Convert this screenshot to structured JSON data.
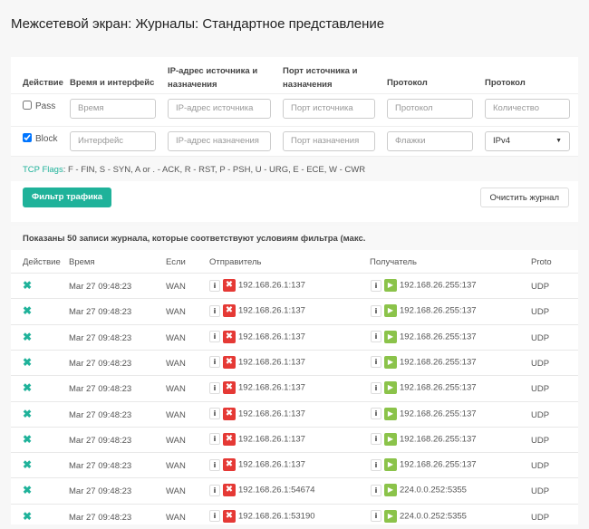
{
  "title": "Межсетевой экран: Журналы: Стандартное представление",
  "filter": {
    "headers": [
      "Действие",
      "Время и интерфейс",
      "IP-адрес источника и назначения",
      "Порт источника и назначения",
      "Протокол",
      "Протокол"
    ],
    "pass_label": "Pass",
    "pass_checked": false,
    "block_label": "Block",
    "block_checked": true,
    "row1": [
      "Время",
      "IP-адрес источника",
      "Порт источника",
      "Протокол",
      "Количество"
    ],
    "row2": [
      "Интерфейс",
      "IP-адрес назначения",
      "Порт назначения",
      "Флажки протокола"
    ],
    "ip_version": "IPv4",
    "tcp_flags_label": "TCP Flags",
    "tcp_flags_text": ": F - FIN, S - SYN, A or . - ACK, R - RST, P - PSH, U - URG, E - ECE, W - CWR",
    "filter_button": "Фильтр трафика",
    "clear_button": "Очистить журнал"
  },
  "logs": {
    "summary": "Показаны 50 записи журнала, которые соответствуют условиям фильтра (макс.",
    "columns": [
      "Действие",
      "Время",
      "Если",
      "Отправитель",
      "Получатель",
      "Proto"
    ],
    "rows": [
      {
        "time": "Mar 27 09:48:23",
        "if": "WAN",
        "src": "192.168.26.1:137",
        "dst": "192.168.26.255:137",
        "proto": "UDP"
      },
      {
        "time": "Mar 27 09:48:23",
        "if": "WAN",
        "src": "192.168.26.1:137",
        "dst": "192.168.26.255:137",
        "proto": "UDP"
      },
      {
        "time": "Mar 27 09:48:23",
        "if": "WAN",
        "src": "192.168.26.1:137",
        "dst": "192.168.26.255:137",
        "proto": "UDP"
      },
      {
        "time": "Mar 27 09:48:23",
        "if": "WAN",
        "src": "192.168.26.1:137",
        "dst": "192.168.26.255:137",
        "proto": "UDP"
      },
      {
        "time": "Mar 27 09:48:23",
        "if": "WAN",
        "src": "192.168.26.1:137",
        "dst": "192.168.26.255:137",
        "proto": "UDP"
      },
      {
        "time": "Mar 27 09:48:23",
        "if": "WAN",
        "src": "192.168.26.1:137",
        "dst": "192.168.26.255:137",
        "proto": "UDP"
      },
      {
        "time": "Mar 27 09:48:23",
        "if": "WAN",
        "src": "192.168.26.1:137",
        "dst": "192.168.26.255:137",
        "proto": "UDP"
      },
      {
        "time": "Mar 27 09:48:23",
        "if": "WAN",
        "src": "192.168.26.1:137",
        "dst": "192.168.26.255:137",
        "proto": "UDP"
      },
      {
        "time": "Mar 27 09:48:23",
        "if": "WAN",
        "src": "192.168.26.1:54674",
        "dst": "224.0.0.252:5355",
        "proto": "UDP"
      },
      {
        "time": "Mar 27 09:48:23",
        "if": "WAN",
        "src": "192.168.26.1:53190",
        "dst": "224.0.0.252:5355",
        "proto": "UDP"
      }
    ]
  }
}
